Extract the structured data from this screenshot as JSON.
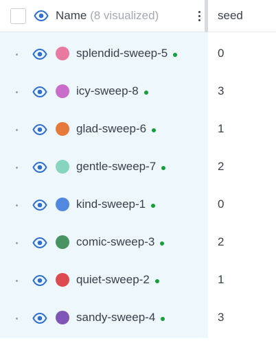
{
  "header": {
    "name_label": "Name",
    "visualized_label": "(8 visualized)",
    "seed_label": "seed",
    "eye_color": "#2f6fd2"
  },
  "status_color": "#12a039",
  "runs": [
    {
      "name": "splendid-sweep-5",
      "seed": "0",
      "color": "#e8799f"
    },
    {
      "name": "icy-sweep-8",
      "seed": "3",
      "color": "#c86dc9"
    },
    {
      "name": "glad-sweep-6",
      "seed": "1",
      "color": "#e8793c"
    },
    {
      "name": "gentle-sweep-7",
      "seed": "2",
      "color": "#87d4bf"
    },
    {
      "name": "kind-sweep-1",
      "seed": "0",
      "color": "#5289e0"
    },
    {
      "name": "comic-sweep-3",
      "seed": "2",
      "color": "#479462"
    },
    {
      "name": "quiet-sweep-2",
      "seed": "1",
      "color": "#dd4b50"
    },
    {
      "name": "sandy-sweep-4",
      "seed": "3",
      "color": "#8055b8"
    }
  ]
}
